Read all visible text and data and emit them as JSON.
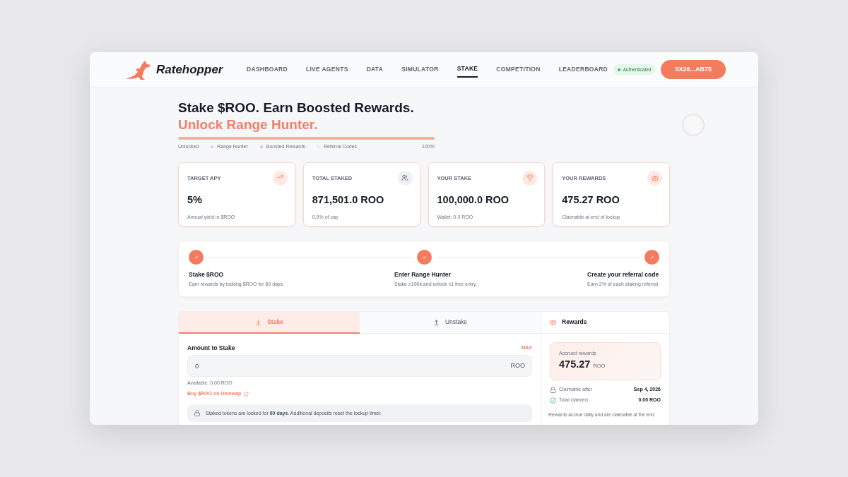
{
  "nav": {
    "logo": "Ratehopper",
    "links": [
      {
        "label": "DASHBOARD",
        "selected": false
      },
      {
        "label": "LIVE AGENTS",
        "selected": false
      },
      {
        "label": "DATA",
        "selected": false
      },
      {
        "label": "SIMULATOR",
        "selected": false
      },
      {
        "label": "STAKE",
        "selected": true
      },
      {
        "label": "COMPETITION",
        "selected": false
      },
      {
        "label": "LEADERBOARD",
        "selected": false
      }
    ],
    "status": "Authenticated",
    "wallet": "0X26...AB75"
  },
  "hero": {
    "title": "Stake $ROO. Earn Boosted Rewards.",
    "subtitle": "Unlock Range Hunter.",
    "level": 1,
    "milestones": [
      {
        "label": "Unlocked",
        "kind": "plain"
      },
      {
        "label": "Range Hunter",
        "kind": "dot"
      },
      {
        "label": "Boosted Rewards",
        "kind": "gift"
      },
      {
        "label": "Referral Codes",
        "kind": "tag"
      }
    ],
    "percent": "100%"
  },
  "stats": [
    {
      "label": "TARGET APY",
      "value": "5%",
      "caption": "Annual yield in $ROO"
    },
    {
      "label": "TOTAL STAKED",
      "value": "871,501.0 ROO",
      "caption": "0.0% of cap"
    },
    {
      "label": "YOUR STAKE",
      "value": "100,000.0 ROO",
      "caption": "Wallet: 0.0 ROO"
    },
    {
      "label": "YOUR REWARDS",
      "value": "475.27 ROO",
      "caption": "Claimable at end of lockup"
    }
  ],
  "steps": [
    {
      "title": "Stake $ROO",
      "text": "Earn rewards by locking $ROO for 60 days.",
      "done": true
    },
    {
      "title": "Enter Range Hunter",
      "text": "Stake ≥100k and unlock x1 free entry.",
      "done": true
    },
    {
      "title": "Create your referral code",
      "text": "Earn 2% of each staking referral.",
      "done": true
    }
  ],
  "tabs": [
    {
      "label": "Stake",
      "selected": true
    },
    {
      "label": "Unstake",
      "selected": false
    }
  ],
  "form": {
    "label": "Amount to Stake",
    "max": "MAX",
    "value": "0",
    "unit": "ROO",
    "available": "Available: 0.00 ROO",
    "link": "Buy $ROO on Uniswap",
    "notice": "Staked tokens are locked for **60 days**. Additional deposits reset the lockup timer."
  },
  "rewards": {
    "title": "Rewards",
    "accrued_label": "Accrued rewards",
    "accrued_value": "475.27",
    "accrued_unit": "ROO",
    "rows": [
      {
        "label": "Claimable after",
        "value": "Sep 4, 2026"
      },
      {
        "label": "Total claimed",
        "value": "0.00 ROO"
      }
    ],
    "note": "Rewards accrue daily and are claimable at the end"
  }
}
